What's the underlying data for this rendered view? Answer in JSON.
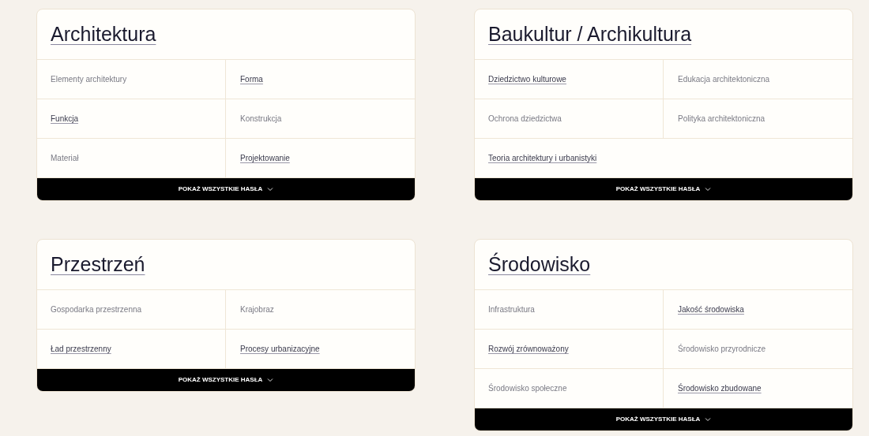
{
  "sections": [
    {
      "title": "Architektura",
      "items": [
        {
          "label": "Elementy architektury",
          "kind": "plain"
        },
        {
          "label": "Forma",
          "kind": "link"
        },
        {
          "label": "Funkcja",
          "kind": "link"
        },
        {
          "label": "Konstrukcja",
          "kind": "plain"
        },
        {
          "label": "Materiał",
          "kind": "plain"
        },
        {
          "label": "Projektowanie",
          "kind": "link"
        }
      ],
      "button": "POKAŻ WSZYSTKIE HASŁA"
    },
    {
      "title": "Przestrzeń",
      "items": [
        {
          "label": "Gospodarka przestrzenna",
          "kind": "plain"
        },
        {
          "label": "Krajobraz",
          "kind": "plain"
        },
        {
          "label": "Ład przestrzenny",
          "kind": "link"
        },
        {
          "label": "Procesy urbanizacyjne",
          "kind": "link"
        }
      ],
      "button": "POKAŻ WSZYSTKIE HASŁA"
    },
    {
      "title": "Baukultur / Archikultura",
      "items": [
        {
          "label": "Dziedzictwo kulturowe",
          "kind": "link"
        },
        {
          "label": "Edukacja architektoniczna",
          "kind": "plain"
        },
        {
          "label": "Ochrona dziedzictwa",
          "kind": "plain"
        },
        {
          "label": "Polityka architektoniczna",
          "kind": "plain"
        },
        {
          "label": "Teoria architektury i urbanistyki",
          "kind": "link"
        }
      ],
      "button": "POKAŻ WSZYSTKIE HASŁA"
    },
    {
      "title": "Środowisko",
      "items": [
        {
          "label": "Infrastruktura",
          "kind": "plain"
        },
        {
          "label": "Jakość środowiska",
          "kind": "link"
        },
        {
          "label": "Rozwój zrównoważony",
          "kind": "link"
        },
        {
          "label": "Środowisko przyrodnicze",
          "kind": "plain"
        },
        {
          "label": "Środowisko społeczne",
          "kind": "plain"
        },
        {
          "label": "Środowisko zbudowane",
          "kind": "link"
        }
      ],
      "button": "POKAŻ WSZYSTKIE HASŁA"
    }
  ]
}
